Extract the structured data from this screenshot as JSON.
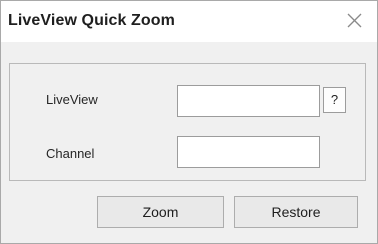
{
  "window": {
    "title": "LiveView Quick Zoom",
    "close_icon": "close-icon"
  },
  "form": {
    "liveview_label": "LiveView",
    "liveview_value": "",
    "help_label": "?",
    "channel_label": "Channel",
    "channel_value": ""
  },
  "buttons": {
    "zoom_label": "Zoom",
    "restore_label": "Restore"
  },
  "colors": {
    "dialog_background": "#f0f0f0",
    "titlebar_background": "#ffffff",
    "border": "#a9a9a9"
  }
}
